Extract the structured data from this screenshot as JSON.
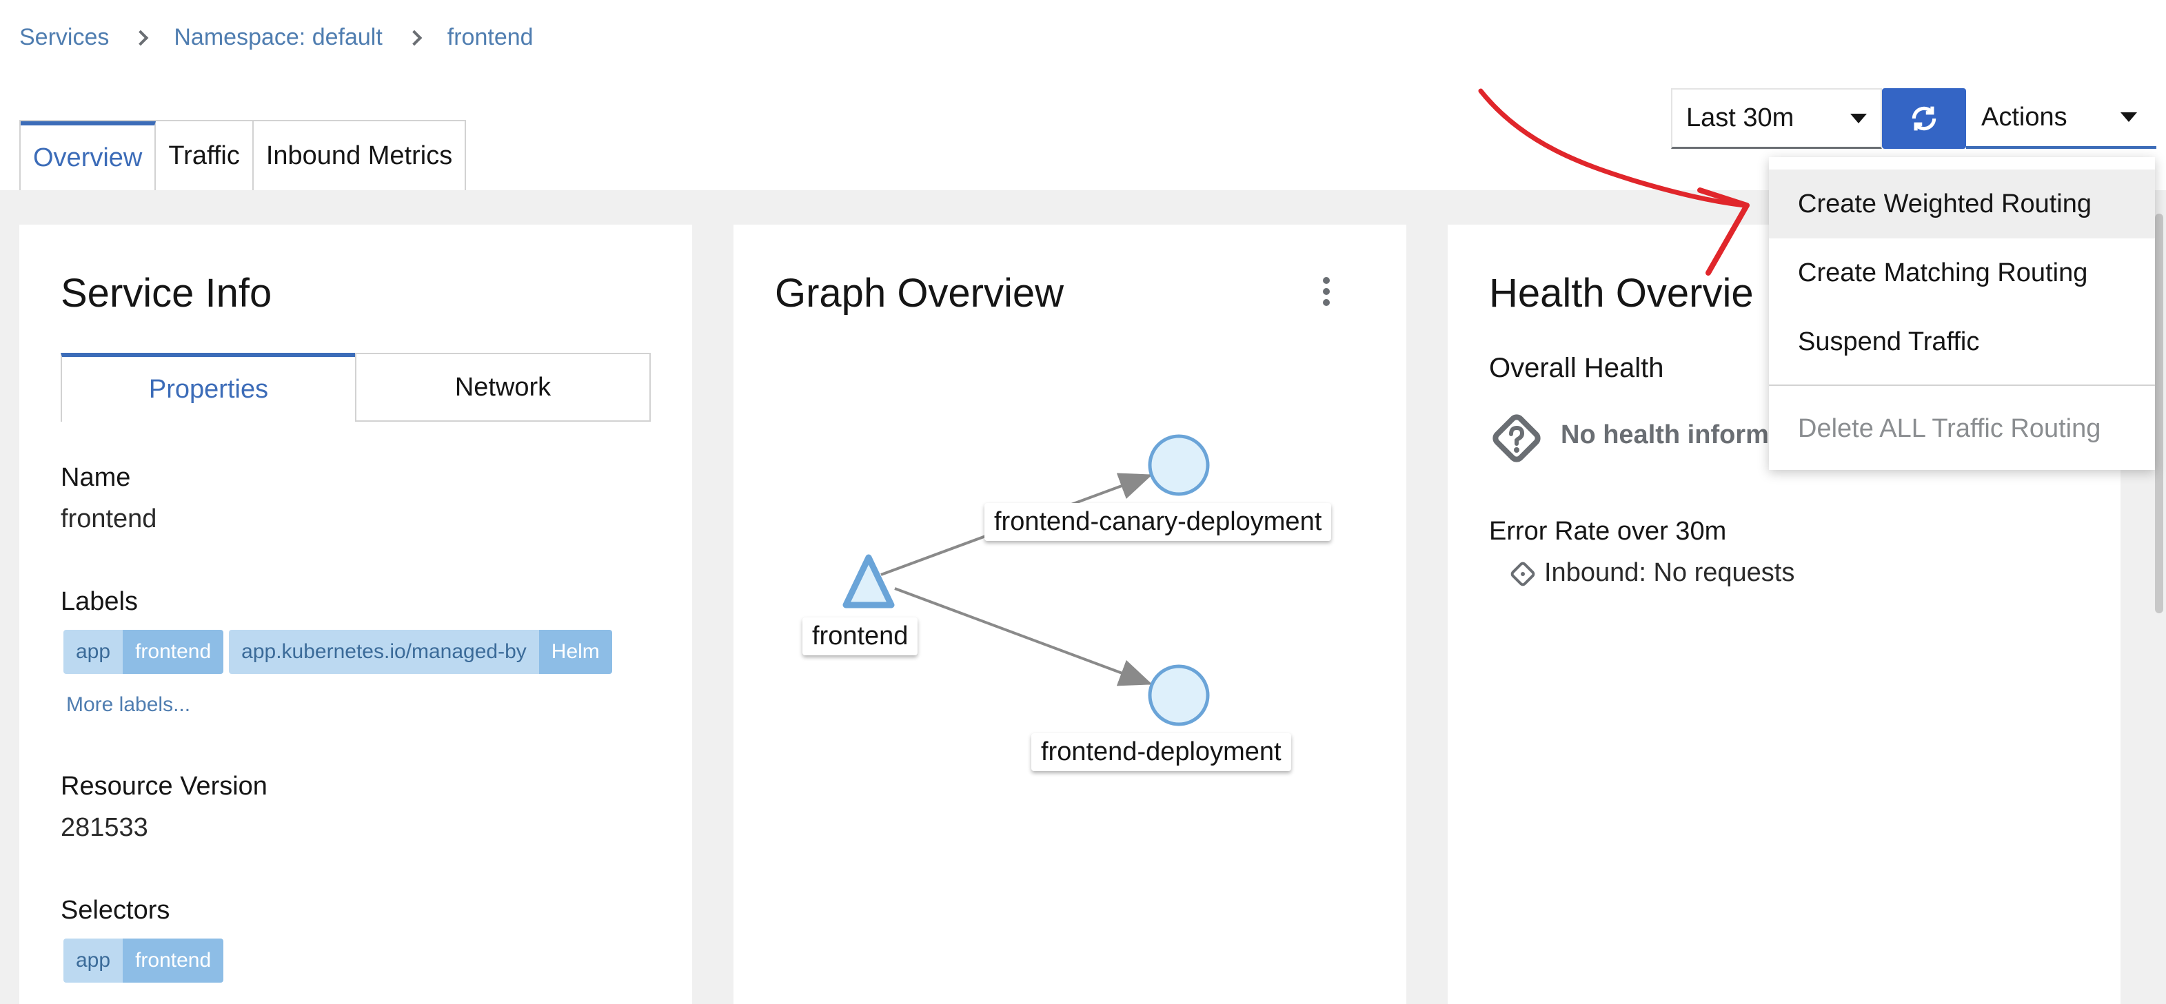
{
  "breadcrumb": {
    "items": [
      "Services",
      "Namespace: default",
      "frontend"
    ]
  },
  "main_tabs": [
    "Overview",
    "Traffic",
    "Inbound Metrics"
  ],
  "toolbar": {
    "time_range": "Last 30m",
    "refresh_icon": "refresh-icon",
    "actions_label": "Actions"
  },
  "service_info": {
    "title": "Service Info",
    "tabs": [
      "Properties",
      "Network"
    ],
    "name_label": "Name",
    "name_value": "frontend",
    "labels_label": "Labels",
    "labels": [
      {
        "key": "app",
        "value": "frontend"
      },
      {
        "key": "app.kubernetes.io/managed-by",
        "value": "Helm"
      }
    ],
    "more_labels": "More labels...",
    "resource_version_label": "Resource Version",
    "resource_version_value": "281533",
    "selectors_label": "Selectors",
    "selectors": [
      {
        "key": "app",
        "value": "frontend"
      }
    ]
  },
  "graph_overview": {
    "title": "Graph Overview",
    "nodes": {
      "service": "frontend",
      "canary": "frontend-canary-deployment",
      "deployment": "frontend-deployment"
    }
  },
  "health_overview": {
    "title": "Health Overvie",
    "overall_health_label": "Overall Health",
    "overall_health_value": "No health inform",
    "error_rate_label": "Error Rate over 30m",
    "error_rate_value": "Inbound: No requests"
  },
  "actions_menu": {
    "items": [
      "Create Weighted Routing",
      "Create Matching Routing",
      "Suspend Traffic"
    ],
    "disabled_item": "Delete ALL Traffic Routing"
  },
  "colors": {
    "accent": "#3c6cb8",
    "refresh_button": "#3465c5",
    "annotation_arrow": "#e0262b",
    "link": "#4f7db0"
  }
}
